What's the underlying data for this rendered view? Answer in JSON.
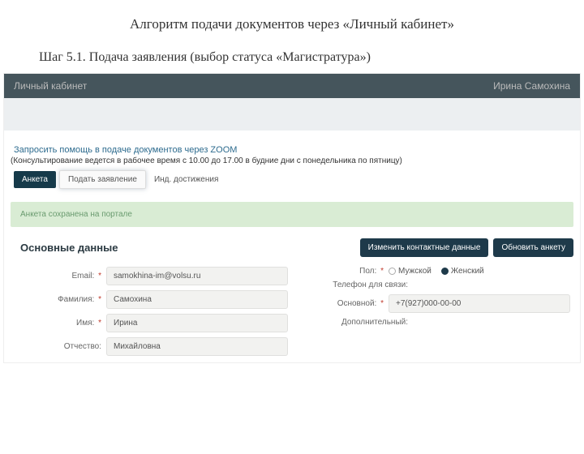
{
  "slide": {
    "title": "Алгоритм подачи документов через «Личный кабинет»",
    "step": "Шаг 5.1. Подача заявления (выбор статуса «Магистратура»)"
  },
  "topbar": {
    "left": "Личный кабинет",
    "right": "Ирина Самохина"
  },
  "zoom": {
    "link": "Запросить помощь в подаче документов через ZOOM",
    "note": "(Консультирование ведется в рабочее время с 10.00 до 17.00 в будние дни с понедельника по пятницу)"
  },
  "tabs": {
    "anketa": "Анкета",
    "submit": "Подать заявление",
    "achievements": "Инд. достижения"
  },
  "banner": "Анкета сохранена на портале",
  "section": {
    "title": "Основные данные",
    "btn_contact": "Изменить контактные данные",
    "btn_refresh": "Обновить анкету"
  },
  "form": {
    "email_label": "Email:",
    "email": "samokhina-im@volsu.ru",
    "surname_label": "Фамилия:",
    "surname": "Самохина",
    "name_label": "Имя:",
    "name": "Ирина",
    "patronymic_label": "Отчество:",
    "patronymic": "Михайловна",
    "gender_label": "Пол:",
    "gender_m": "Мужской",
    "gender_f": "Женский",
    "phone_label": "Телефон для связи:",
    "main_label": "Основной:",
    "main_phone": "+7(927)000-00-00",
    "extra_label": "Дополнительный:"
  }
}
